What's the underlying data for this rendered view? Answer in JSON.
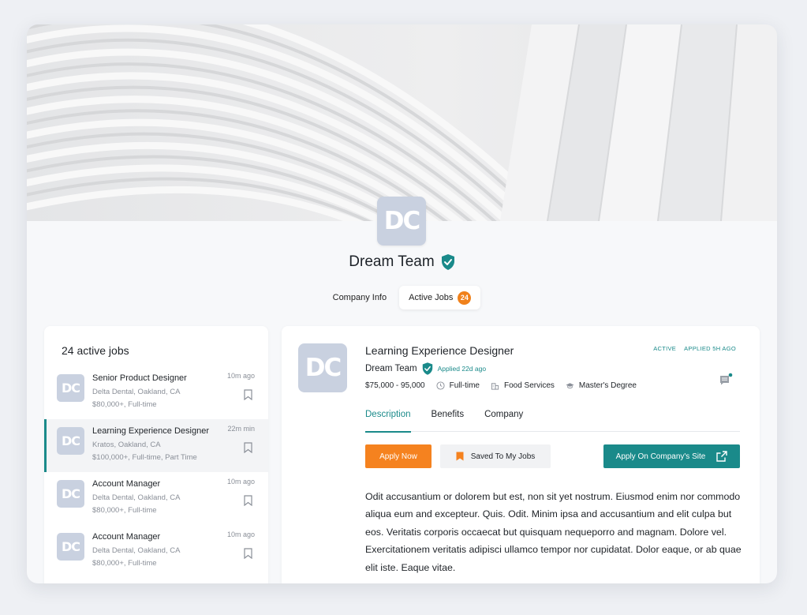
{
  "company": {
    "initials": "DC",
    "name": "Dream Team",
    "verified": true
  },
  "top_tabs": [
    {
      "label": "Company Info",
      "active": false
    },
    {
      "label": "Active Jobs",
      "active": true,
      "badge": "24"
    }
  ],
  "job_list": {
    "title": "24 active jobs",
    "items": [
      {
        "initials": "DC",
        "title": "Senior Product Designer",
        "location": "Delta Dental, Oakland, CA",
        "pay": "$80,000+, Full-time",
        "time": "10m ago",
        "selected": false
      },
      {
        "initials": "DC",
        "title": "Learning Experience Designer",
        "location": "Kratos, Oakland, CA",
        "pay": "$100,000+, Full-time, Part Time",
        "time": "22m min",
        "selected": true
      },
      {
        "initials": "DC",
        "title": "Account Manager",
        "location": "Delta Dental, Oakland, CA",
        "pay": "$80,000+, Full-time",
        "time": "10m ago",
        "selected": false
      },
      {
        "initials": "DC",
        "title": "Account Manager",
        "location": "Delta Dental, Oakland, CA",
        "pay": "$80,000+, Full-time",
        "time": "10m ago",
        "selected": false
      }
    ]
  },
  "detail": {
    "initials": "DC",
    "title": "Learning Experience Designer",
    "company": "Dream Team",
    "applied": "Applied 22d ago",
    "status": "ACTIVE",
    "applied_ago": "APPLIED 5H AGO",
    "salary": "$75,000 - 95,000",
    "type": "Full-time",
    "industry": "Food Services",
    "education": "Master's Degree",
    "tabs": [
      "Description",
      "Benefits",
      "Company"
    ],
    "apply_label": "Apply Now",
    "saved_label": "Saved To My Jobs",
    "site_label": "Apply On Company's Site",
    "description": "Odit accusantium or dolorem but est, non sit yet nostrum. Eiusmod enim nor commodo aliqua eum and excepteur. Quis. Odit. Minim ipsa and accusantium and elit culpa but eos. Veritatis corporis occaecat but quisquam neque­porro and magnam. Dolore vel. Exercitationem veritatis adipisci ullamco tempor nor cupidatat. Dolor eaque, or ab quae elit iste. Eaque vitae."
  },
  "colors": {
    "accent": "#1a8a8a",
    "orange": "#f5821f",
    "logo_bg": "#c9d1e0"
  }
}
